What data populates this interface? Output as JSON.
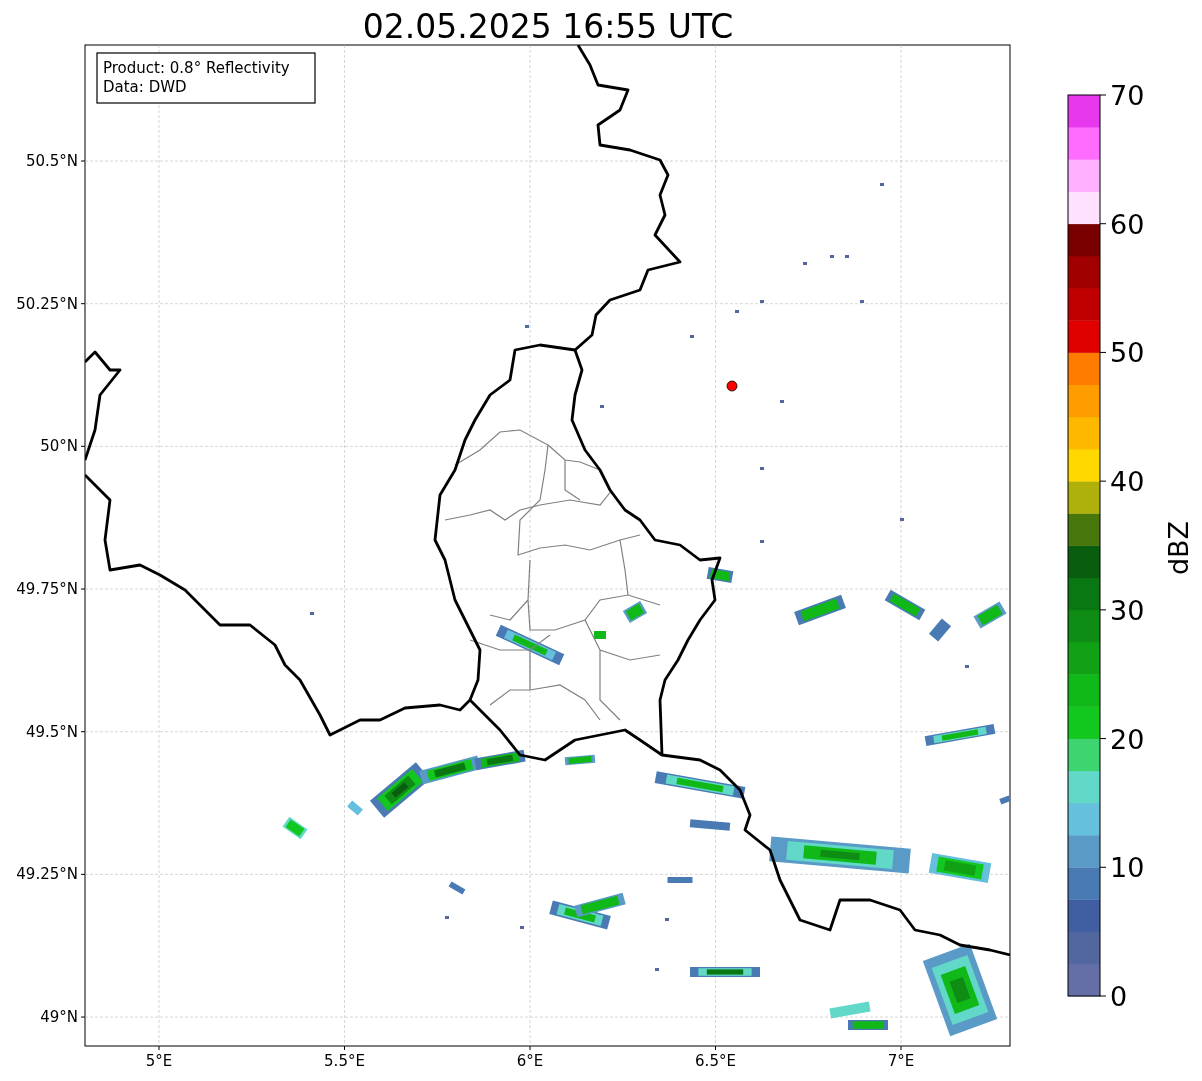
{
  "title": "02.05.2025 16:55 UTC",
  "info_box": [
    "Product: 0.8° Reflectivity",
    "Data: DWD"
  ],
  "map": {
    "lon_ticks": [
      "5°E",
      "5.5°E",
      "6°E",
      "6.5°E",
      "7°E"
    ],
    "lat_ticks": [
      "50.5°N",
      "50.25°N",
      "50°N",
      "49.75°N",
      "49.5°N",
      "49.25°N",
      "49°N"
    ]
  },
  "colorbar": {
    "label": "dBZ",
    "ticks": [
      "70",
      "60",
      "50",
      "40",
      "30",
      "20",
      "10",
      "0"
    ]
  }
}
